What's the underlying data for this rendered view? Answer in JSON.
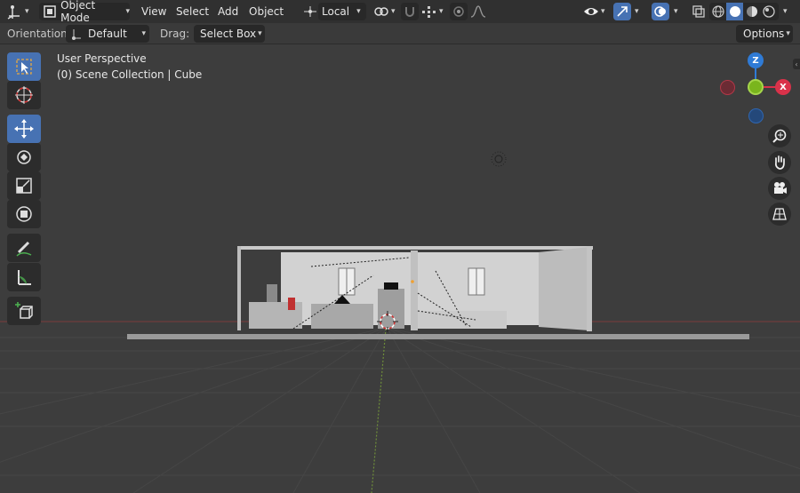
{
  "header": {
    "mode_label": "Object Mode",
    "menus": [
      "View",
      "Select",
      "Add",
      "Object"
    ],
    "transform_orientation": "Local"
  },
  "tool_settings": {
    "orientation_label": "Orientation:",
    "orientation_value": "Default",
    "drag_label": "Drag:",
    "drag_value": "Select Box",
    "options_label": "Options"
  },
  "viewport": {
    "view_name": "User Perspective",
    "collection_info": "(0) Scene Collection | Cube"
  },
  "gizmo": {
    "z_label": "Z",
    "x_label": "X",
    "colors": {
      "x": "#d9324a",
      "y": "#7ab51d",
      "z": "#2f7bd6"
    }
  },
  "icons": {
    "editor_type": "axes-icon",
    "mode": "cube-icon",
    "pivot": "pivot-icon",
    "snap": "magnet-icon",
    "proportional": "proportional-icon",
    "visibility": "eye-icon",
    "gizmo": "gizmo-icon",
    "overlays": "overlay-icon",
    "xray": "xray-icon",
    "shading": [
      "wireframe-icon",
      "solid-icon",
      "material-icon",
      "rendered-icon"
    ]
  }
}
